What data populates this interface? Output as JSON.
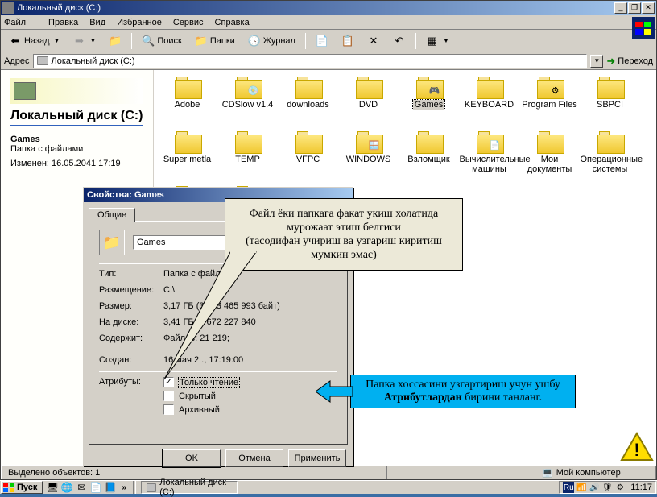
{
  "window": {
    "title": "Локальный диск (C:)",
    "menu": {
      "file": "Файл",
      "edit": "Правка",
      "view": "Вид",
      "fav": "Избранное",
      "tools": "Сервис",
      "help": "Справка"
    },
    "toolbar": {
      "back": "Назад",
      "search": "Поиск",
      "folders": "Папки",
      "journal": "Журнал"
    },
    "address_label": "Адрес",
    "address_value": "Локальный диск (C:)",
    "go_label": "Переход"
  },
  "sidebar": {
    "title": "Локальный диск (C:)",
    "selected_name": "Games",
    "selected_type": "Папка с файлами",
    "modified": "Изменен: 16.05.2041 17:19"
  },
  "folders": [
    {
      "label": "Adobe",
      "overlay": ""
    },
    {
      "label": "CDSlow v1.4",
      "overlay": "cd"
    },
    {
      "label": "downloads",
      "overlay": ""
    },
    {
      "label": "DVD",
      "overlay": ""
    },
    {
      "label": "Games",
      "overlay": "game",
      "selected": true
    },
    {
      "label": "KEYBOARD",
      "overlay": ""
    },
    {
      "label": "Program Files",
      "overlay": "prog"
    },
    {
      "label": "SBPCI",
      "overlay": ""
    },
    {
      "label": "Super metla",
      "overlay": ""
    },
    {
      "label": "TEMP",
      "overlay": ""
    },
    {
      "label": "VFPC",
      "overlay": ""
    },
    {
      "label": "WINDOWS",
      "overlay": "win"
    },
    {
      "label": "Взломщик",
      "overlay": ""
    },
    {
      "label": "Вычислительные машины",
      "overlay": "doc"
    },
    {
      "label": "Мои документы",
      "overlay": ""
    },
    {
      "label": "Операционные системы",
      "overlay": ""
    },
    {
      "label": "",
      "overlay": ""
    },
    {
      "label": "",
      "overlay": ""
    }
  ],
  "statusbar": {
    "selected": "Выделено объектов: 1",
    "location": "Мой компьютер"
  },
  "dialog": {
    "title": "Свойства: Games",
    "tab_general": "Общие",
    "name": "Games",
    "rows": {
      "type_label": "Тип:",
      "type_val": "Папка с файлами",
      "loc_label": "Размещение:",
      "loc_val": "C:\\",
      "size_label": "Размер:",
      "size_val": "3,17 ГБ (3 413 465 993 байт)",
      "ondisk_label": "На диске:",
      "ondisk_val": "3,41 ГБ (3 672 227 840 ",
      "contains_label": "Содержит:",
      "contains_val": "Файлов: 21 219;",
      "created_label": "Создан:",
      "created_val": "16 мая 2     ., 17:19:00",
      "attrs_label": "Атрибуты:"
    },
    "chk": {
      "readonly": "Только чтение",
      "hidden": "Скрытый",
      "archive": "Архивный"
    },
    "btn": {
      "ok": "OK",
      "cancel": "Отмена",
      "apply": "Применить"
    }
  },
  "callout1": {
    "line1": "Файл ёки папкага факат укиш холатида мурожаат этиш белгиси",
    "line2": "(тасодифан учириш ва узгариш киритиш мумкин эмас)"
  },
  "callout2": {
    "pre": "Папка хоссасини узгартириш учун ушбу ",
    "bold": "Атрибутлардан",
    "post": "  бирини танланг."
  },
  "taskbar": {
    "start": "Пуск",
    "task1": "Локальный диск (C:)",
    "lang": "Ru",
    "clock": "11:17"
  }
}
